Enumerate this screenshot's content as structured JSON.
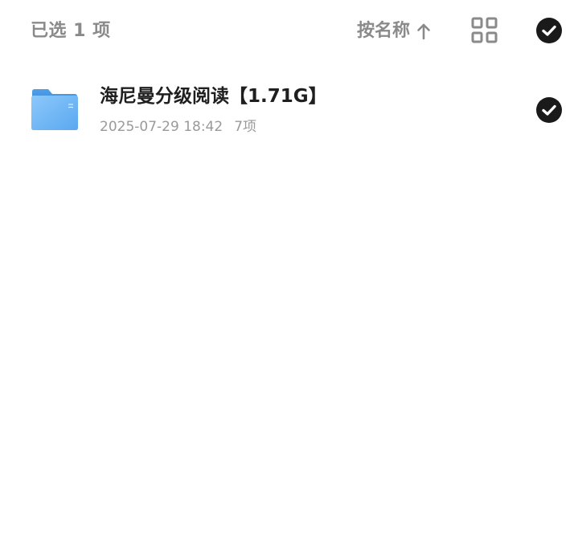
{
  "toolbar": {
    "selected_label": "已选 1 项",
    "sort_label": "按名称",
    "sort_direction_icon": "arrow-up-icon",
    "view_toggle_icon": "grid-view-icon",
    "select_all_icon": "check-circle-icon"
  },
  "files": [
    {
      "name": "海尼曼分级阅读【1.71G】",
      "date": "2025-07-29 18:42",
      "count": "7项",
      "icon": "folder-icon",
      "selected": true
    }
  ],
  "colors": {
    "muted_text": "#8a8a8a",
    "primary_text": "#1f1f1f",
    "check_fill": "#1a1a1a",
    "folder_blue": "#6bb4f5"
  }
}
